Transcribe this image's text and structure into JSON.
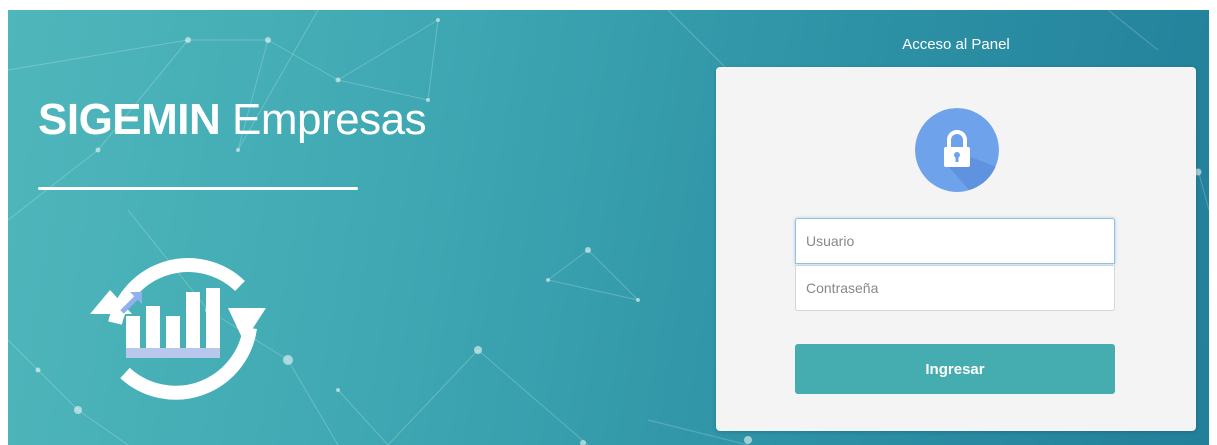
{
  "brand": {
    "name_strong": "SIGEMIN",
    "name_light": "Empresas",
    "logo": "sync-bar-chart-icon"
  },
  "login": {
    "heading": "Acceso al Panel",
    "lock_icon": "lock-icon",
    "username_placeholder": "Usuario",
    "password_placeholder": "Contraseña",
    "submit_label": "Ingresar"
  },
  "colors": {
    "background_start": "#4fb7bb",
    "background_end": "#22809a",
    "card": "#f4f4f4",
    "button": "#45acb0",
    "lock_badge": "#6ea3ec",
    "logo_bars_light": "#b8c8ec",
    "logo_arrow_accent": "#8fb1ef"
  }
}
